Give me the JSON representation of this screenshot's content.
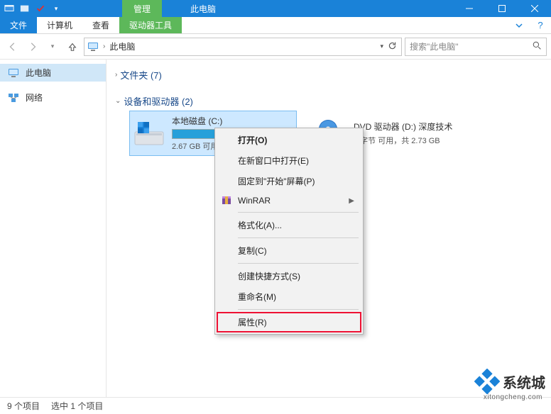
{
  "titlebar": {
    "ribbon_tab": "管理",
    "title": "此电脑"
  },
  "ribbon": {
    "file": "文件",
    "computer": "计算机",
    "view": "查看",
    "drive_tools": "驱动器工具"
  },
  "nav": {
    "breadcrumb": "此电脑",
    "search_placeholder": "搜索\"此电脑\""
  },
  "sidebar": {
    "items": [
      "此电脑",
      "网络"
    ]
  },
  "content": {
    "group_folders": "文件夹 (7)",
    "group_drives": "设备和驱动器 (2)",
    "drive_c": {
      "name": "本地磁盘 (C:)",
      "free_text": "2.67 GB 可用",
      "fill_percent": 95
    },
    "drive_d": {
      "name": "DVD 驱动器 (D:) 深度技术",
      "free_text": "0 字节 可用，共 2.73 GB"
    }
  },
  "context_menu": {
    "open": "打开(O)",
    "open_new": "在新窗口中打开(E)",
    "pin_start": "固定到\"开始\"屏幕(P)",
    "winrar": "WinRAR",
    "format": "格式化(A)...",
    "copy": "复制(C)",
    "create_shortcut": "创建快捷方式(S)",
    "rename": "重命名(M)",
    "properties": "属性(R)"
  },
  "statusbar": {
    "items": "9 个项目",
    "selected": "选中 1 个项目"
  },
  "watermark": {
    "text": "系统城",
    "sub": "xitongcheng.com"
  }
}
